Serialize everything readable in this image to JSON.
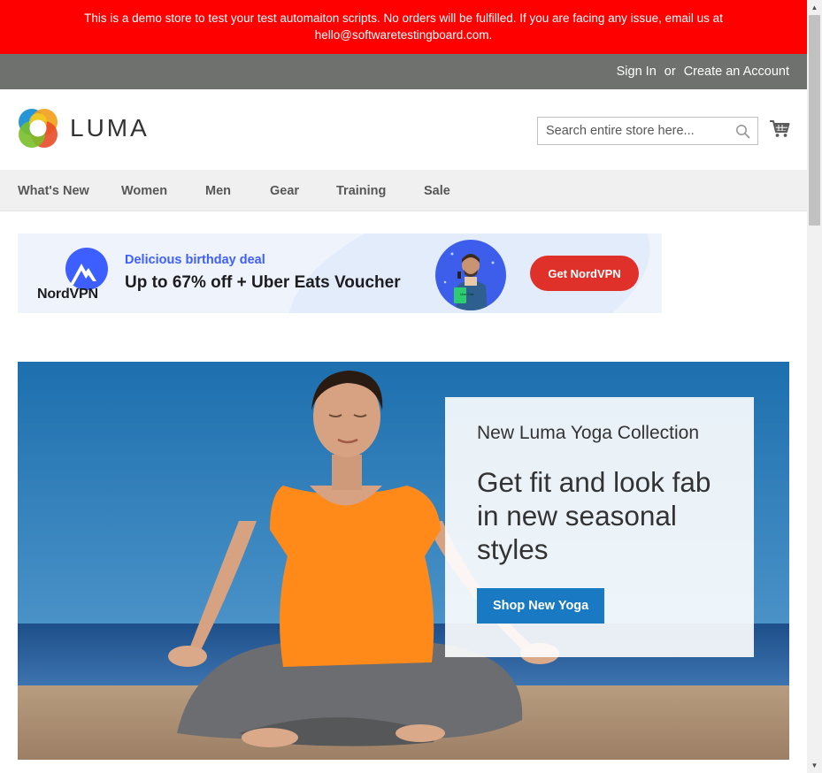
{
  "demo_notice": {
    "line1": "This is a demo store to test your test automaiton scripts. No orders will be fulfilled. If you are facing any issue, email us at",
    "line2": "hello@softwaretestingboard.com."
  },
  "header": {
    "sign_in": "Sign In",
    "or": "or",
    "create_account": "Create an Account"
  },
  "logo": {
    "text": "LUMA"
  },
  "search": {
    "placeholder": "Search entire store here...",
    "value": ""
  },
  "nav": {
    "items": [
      {
        "label": "What's New"
      },
      {
        "label": "Women"
      },
      {
        "label": "Men"
      },
      {
        "label": "Gear"
      },
      {
        "label": "Training"
      },
      {
        "label": "Sale"
      }
    ]
  },
  "ad": {
    "brand": "NordVPN",
    "kicker": "Delicious birthday deal",
    "headline": "Up to 67% off + Uber Eats Voucher",
    "cta": "Get NordVPN",
    "bag_text": "Uber Eats"
  },
  "hero": {
    "kicker": "New Luma Yoga Collection",
    "title_line1": "Get fit and look fab",
    "title_line2": "in new seasonal",
    "title_line3": "styles",
    "cta": "Shop New Yoga"
  },
  "colors": {
    "notice_bg": "#ff0000",
    "header_bg": "#6e716e",
    "nav_bg": "#f0f0f0",
    "primary_button": "#1979c3",
    "ad_button": "#e0302a",
    "ad_kicker": "#3e5fff"
  }
}
